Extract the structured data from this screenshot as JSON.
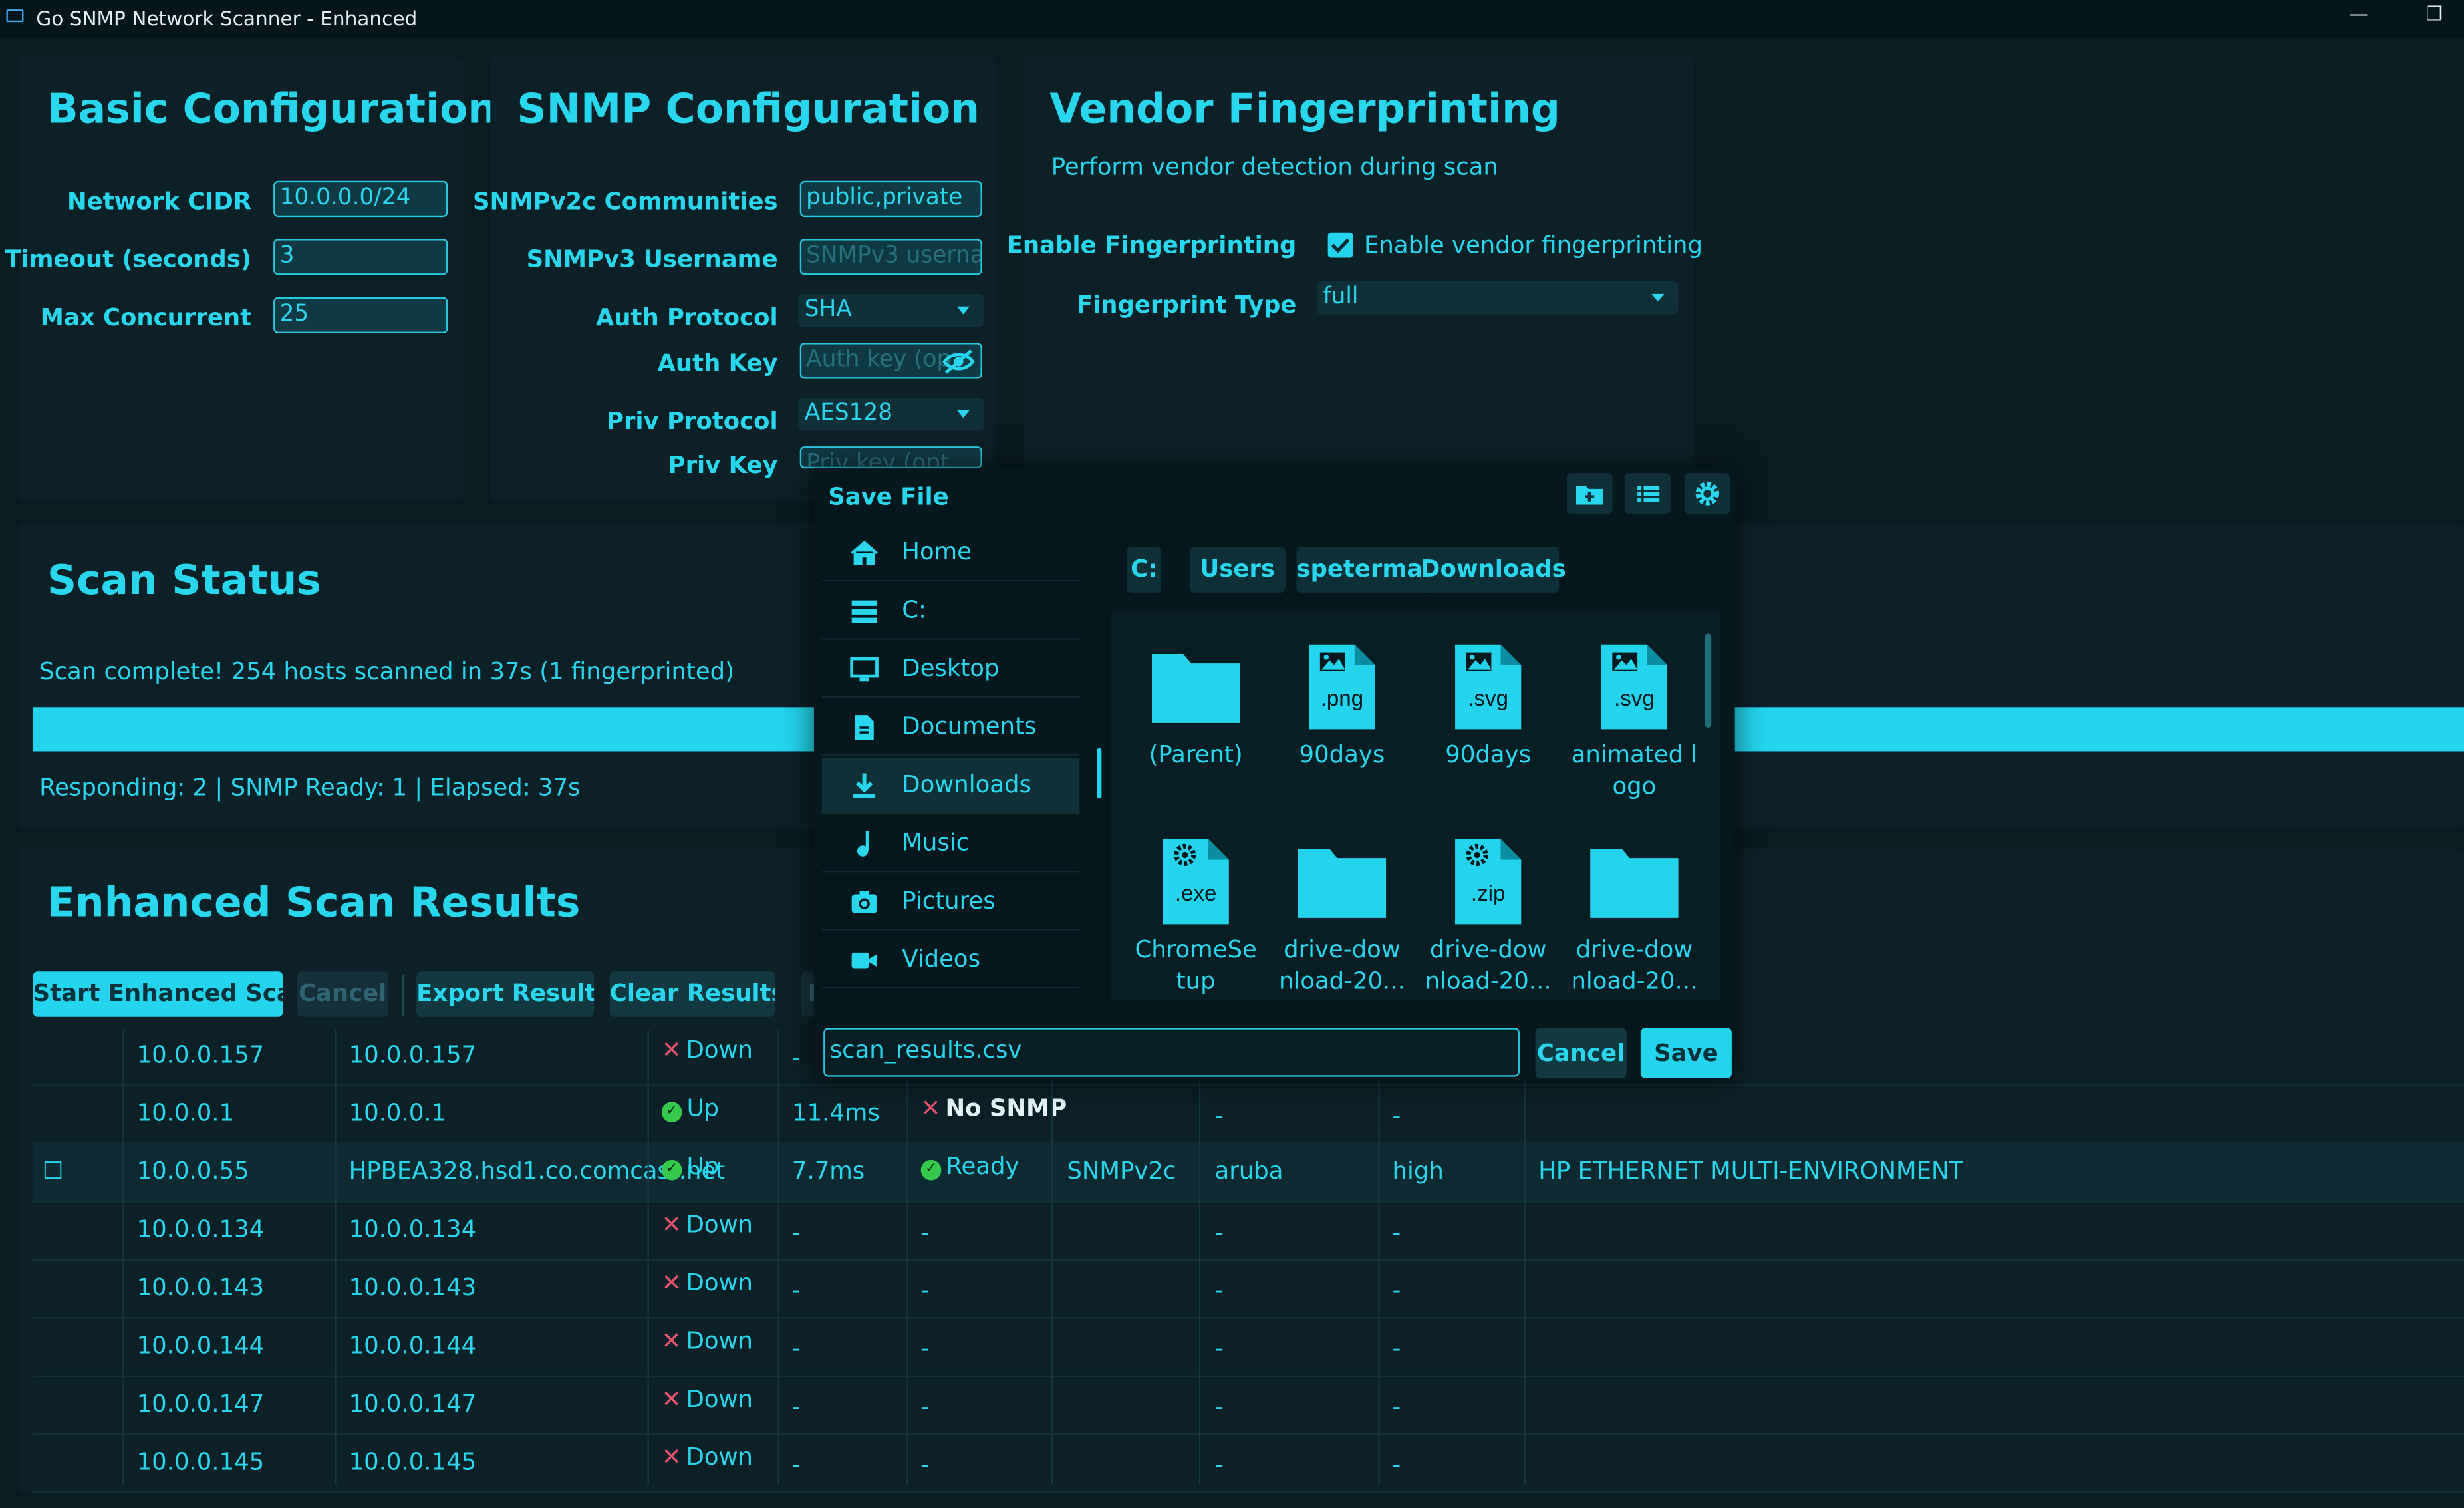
{
  "window": {
    "title": "Go SNMP Network Scanner - Enhanced"
  },
  "basic": {
    "title": "Basic Configuration",
    "network_cidr_label": "Network CIDR",
    "network_cidr": "10.0.0.0/24",
    "timeout_label": "Timeout (seconds)",
    "timeout": "3",
    "max_concurrent_label": "Max Concurrent",
    "max_concurrent": "25"
  },
  "snmp": {
    "title": "SNMP Configuration",
    "communities_label": "SNMPv2c Communities",
    "communities": "public,private",
    "v3_user_label": "SNMPv3 Username",
    "v3_user_placeholder": "SNMPv3 usernam",
    "auth_protocol_label": "Auth Protocol",
    "auth_protocol": "SHA",
    "auth_key_label": "Auth Key",
    "auth_key_placeholder": "Auth key (op",
    "priv_protocol_label": "Priv Protocol",
    "priv_protocol": "AES128",
    "priv_key_label": "Priv Key",
    "priv_key_placeholder": "Priv key (opt"
  },
  "vendor": {
    "title": "Vendor Fingerprinting",
    "subtitle": "Perform vendor detection during scan",
    "enable_label": "Enable Fingerprinting",
    "enable_checkbox_label": "Enable vendor fingerprinting",
    "enable_checked": true,
    "type_label": "Fingerprint Type",
    "type_value": "full"
  },
  "scan_status": {
    "title": "Scan Status",
    "message": "Scan complete! 254 hosts scanned in 37s (1 fingerprinted)",
    "progress": 1.0,
    "stats": "Responding: 2 | SNMP Ready: 1 | Elapsed: 37s"
  },
  "results": {
    "title": "Enhanced Scan Results",
    "buttons": {
      "start": "Start Enhanced Scan",
      "cancel": "Cancel",
      "export": "Export Results",
      "clear": "Clear Results",
      "partial": "F"
    },
    "rows": [
      {
        "check": "",
        "ip": "10.0.0.157",
        "host": "10.0.0.157",
        "status": "Down",
        "up": false,
        "rtt": "-",
        "snmp": "",
        "snmp_state": "",
        "ver": "",
        "vendor": "",
        "conf": "",
        "desc": ""
      },
      {
        "check": "",
        "ip": "10.0.0.1",
        "host": "10.0.0.1",
        "status": "Up",
        "up": true,
        "rtt": "11.4ms",
        "snmp": "No SNMP",
        "snmp_state": "none",
        "ver": "",
        "vendor": "-",
        "conf": "-",
        "desc": ""
      },
      {
        "check": "☐",
        "ip": "10.0.0.55",
        "host": "HPBEA328.hsd1.co.comcast.net",
        "status": "Up",
        "up": true,
        "rtt": "7.7ms",
        "snmp": "Ready",
        "snmp_state": "ready",
        "ver": "SNMPv2c",
        "vendor": "aruba",
        "conf": "high",
        "desc": "HP ETHERNET MULTI-ENVIRONMENT"
      },
      {
        "check": "",
        "ip": "10.0.0.134",
        "host": "10.0.0.134",
        "status": "Down",
        "up": false,
        "rtt": "-",
        "snmp": "-",
        "snmp_state": "dash",
        "ver": "",
        "vendor": "-",
        "conf": "-",
        "desc": ""
      },
      {
        "check": "",
        "ip": "10.0.0.143",
        "host": "10.0.0.143",
        "status": "Down",
        "up": false,
        "rtt": "-",
        "snmp": "-",
        "snmp_state": "dash",
        "ver": "",
        "vendor": "-",
        "conf": "-",
        "desc": ""
      },
      {
        "check": "",
        "ip": "10.0.0.144",
        "host": "10.0.0.144",
        "status": "Down",
        "up": false,
        "rtt": "-",
        "snmp": "-",
        "snmp_state": "dash",
        "ver": "",
        "vendor": "-",
        "conf": "-",
        "desc": ""
      },
      {
        "check": "",
        "ip": "10.0.0.147",
        "host": "10.0.0.147",
        "status": "Down",
        "up": false,
        "rtt": "-",
        "snmp": "-",
        "snmp_state": "dash",
        "ver": "",
        "vendor": "-",
        "conf": "-",
        "desc": ""
      },
      {
        "check": "",
        "ip": "10.0.0.145",
        "host": "10.0.0.145",
        "status": "Down",
        "up": false,
        "rtt": "-",
        "snmp": "-",
        "snmp_state": "dash",
        "ver": "",
        "vendor": "-",
        "conf": "-",
        "desc": ""
      }
    ]
  },
  "dialog": {
    "title": "Save File",
    "places": [
      {
        "label": "Home",
        "icon": "home-icon"
      },
      {
        "label": "C:",
        "icon": "drive-icon"
      },
      {
        "label": "Desktop",
        "icon": "desktop-icon"
      },
      {
        "label": "Documents",
        "icon": "document-icon"
      },
      {
        "label": "Downloads",
        "icon": "download-icon",
        "selected": true
      },
      {
        "label": "Music",
        "icon": "music-icon"
      },
      {
        "label": "Pictures",
        "icon": "camera-icon"
      },
      {
        "label": "Videos",
        "icon": "video-icon"
      }
    ],
    "breadcrumb": [
      "C:",
      "Users",
      "speterman",
      "Downloads"
    ],
    "files": [
      {
        "name": "(Parent)",
        "kind": "folder",
        "ext": ""
      },
      {
        "name": "90days",
        "kind": "image",
        "ext": ".png"
      },
      {
        "name": "90days",
        "kind": "image",
        "ext": ".svg"
      },
      {
        "name": "animated l\nogo",
        "kind": "image",
        "ext": ".svg"
      },
      {
        "name": "ChromeSe\ntup",
        "kind": "gear",
        "ext": ".exe"
      },
      {
        "name": "drive-dow\nnload-20...",
        "kind": "folder",
        "ext": ""
      },
      {
        "name": "drive-dow\nnload-20...",
        "kind": "gear",
        "ext": ".zip"
      },
      {
        "name": "drive-dow\nnload-20...",
        "kind": "folder",
        "ext": ""
      }
    ],
    "filename": "scan_results.csv",
    "cancel_label": "Cancel",
    "save_label": "Save"
  },
  "colors": {
    "accent": "#24d3ec",
    "background": "#081c22",
    "down": "#e2536d",
    "ok": "#35c94d"
  }
}
